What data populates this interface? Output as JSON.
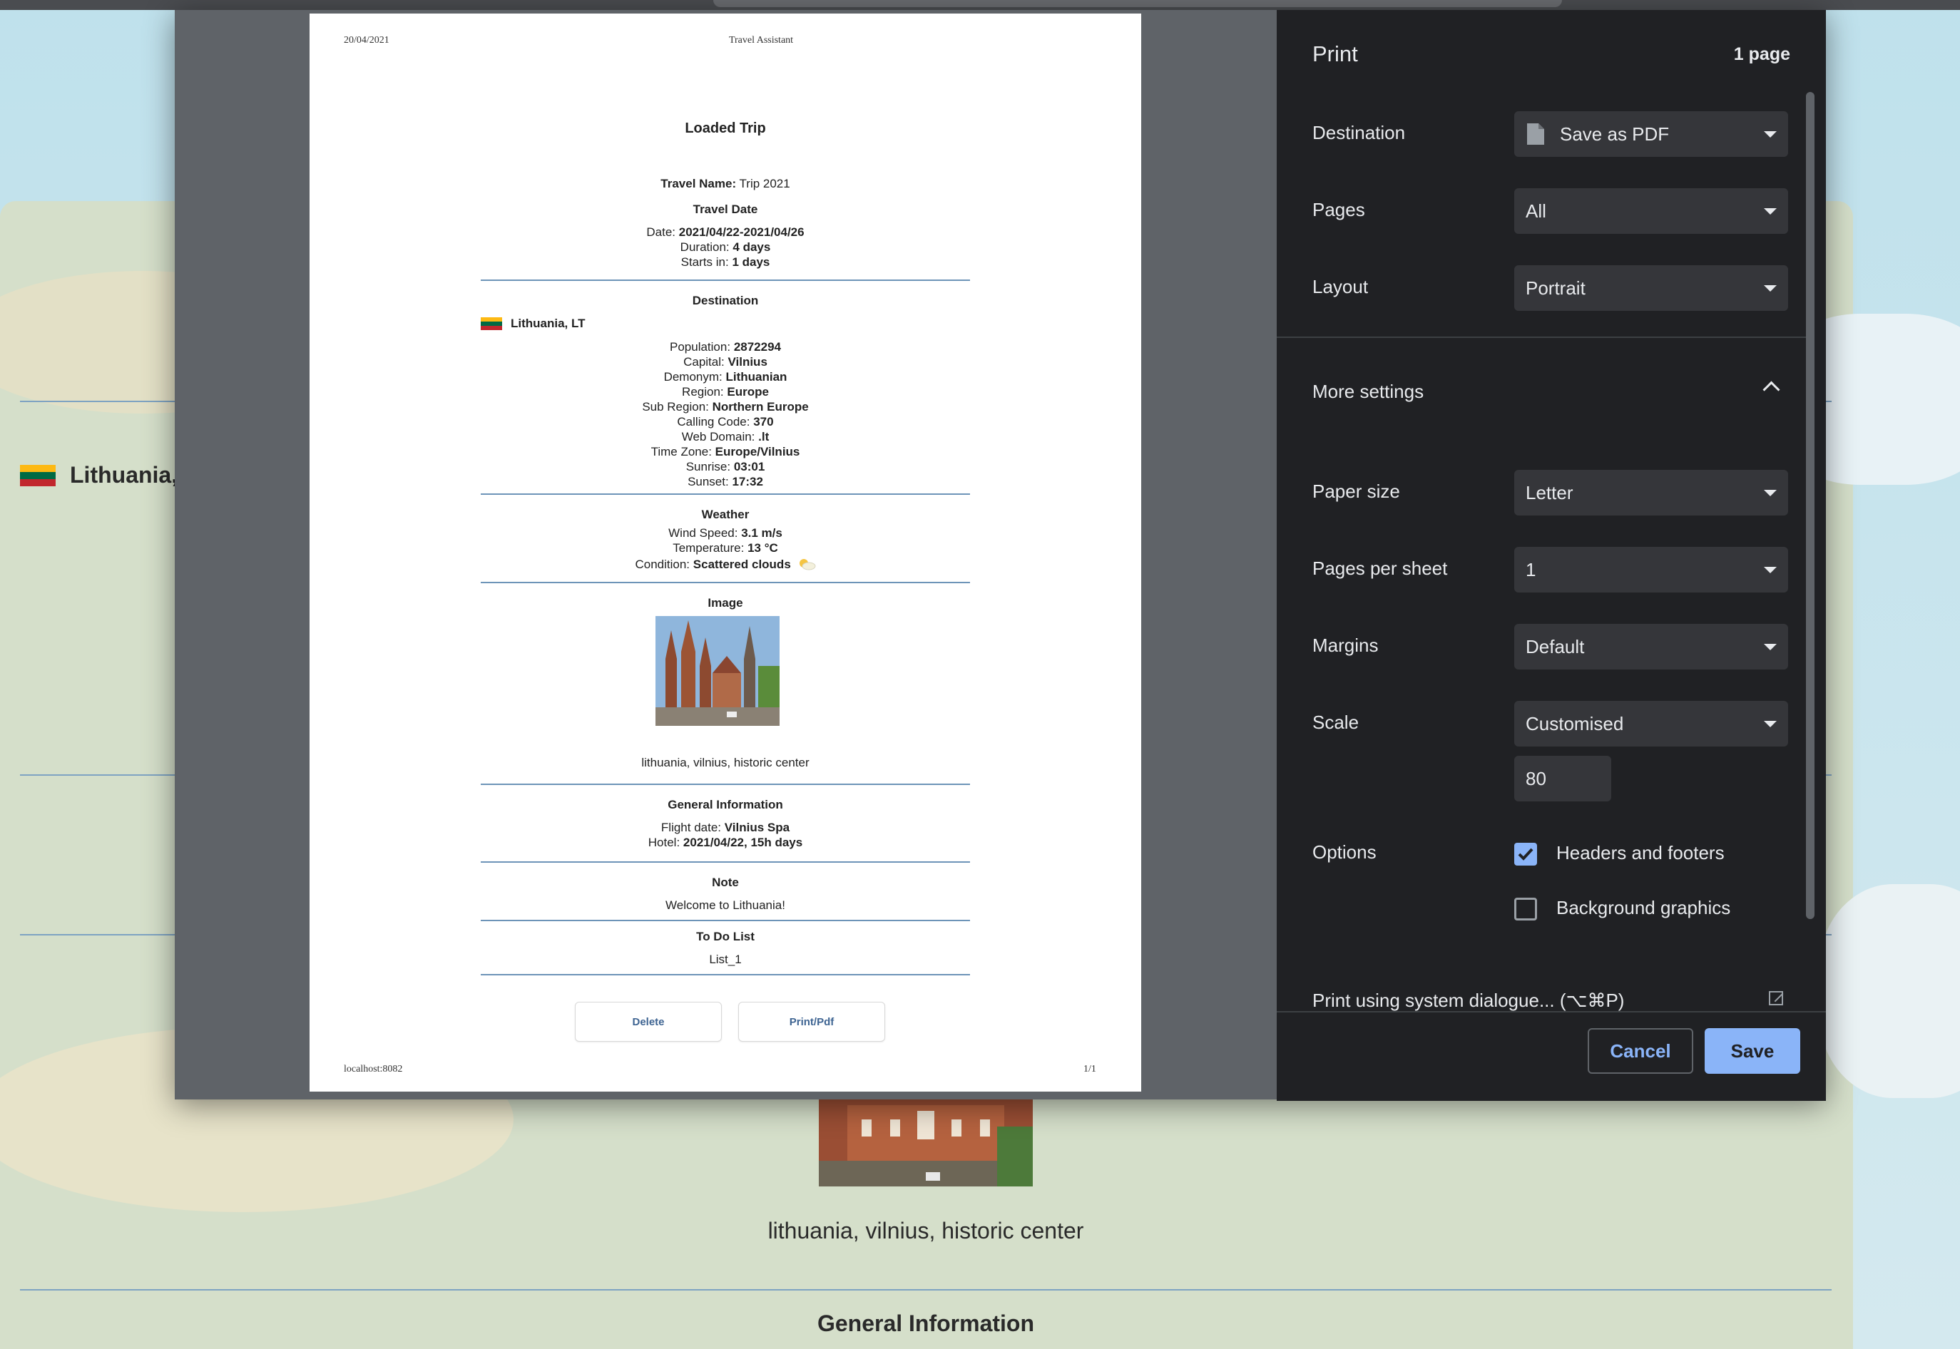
{
  "background": {
    "country": "Lithuania,",
    "image_caption": "lithuania, vilnius, historic center",
    "section_title": "General Information"
  },
  "preview": {
    "header_date": "20/04/2021",
    "header_title": "Travel Assistant",
    "footer_url": "localhost:8082",
    "footer_page": "1/1",
    "page_title": "Loaded Trip",
    "travel_name_label": "Travel Name:",
    "travel_name": "Trip 2021",
    "travel_date_heading": "Travel Date",
    "date_label": "Date:",
    "date_value": "2021/04/22-2021/04/26",
    "duration_label": "Duration:",
    "duration_value": "4 days",
    "starts_label": "Starts in:",
    "starts_value": "1 days",
    "destination_heading": "Destination",
    "country": "Lithuania, LT",
    "facts": [
      {
        "label": "Population:",
        "value": "2872294"
      },
      {
        "label": "Capital:",
        "value": "Vilnius"
      },
      {
        "label": "Demonym:",
        "value": "Lithuanian"
      },
      {
        "label": "Region:",
        "value": "Europe"
      },
      {
        "label": "Sub Region:",
        "value": "Northern Europe"
      },
      {
        "label": "Calling Code:",
        "value": "370"
      },
      {
        "label": "Web Domain:",
        "value": ".lt"
      },
      {
        "label": "Time Zone:",
        "value": "Europe/Vilnius"
      },
      {
        "label": "Sunrise:",
        "value": "03:01"
      },
      {
        "label": "Sunset:",
        "value": "17:32"
      }
    ],
    "weather_heading": "Weather",
    "wind_label": "Wind Speed:",
    "wind_value": "3.1 m/s",
    "temp_label": "Temperature:",
    "temp_value": "13 °C",
    "condition_label": "Condition:",
    "condition_value": "Scattered clouds",
    "image_heading": "Image",
    "image_caption": "lithuania, vilnius, historic center",
    "general_heading": "General Information",
    "flight_label": "Flight date:",
    "flight_value": "Vilnius Spa",
    "hotel_label": "Hotel:",
    "hotel_value": "2021/04/22, 15h days",
    "note_heading": "Note",
    "note_text": "Welcome to Lithuania!",
    "todo_heading": "To Do List",
    "todo_item": "List_1",
    "delete_button": "Delete",
    "print_button": "Print/Pdf"
  },
  "print_panel": {
    "title": "Print",
    "page_count": "1 page",
    "destination_label": "Destination",
    "destination_value": "Save as PDF",
    "pages_label": "Pages",
    "pages_value": "All",
    "layout_label": "Layout",
    "layout_value": "Portrait",
    "more_settings_label": "More settings",
    "paper_size_label": "Paper size",
    "paper_size_value": "Letter",
    "pages_per_sheet_label": "Pages per sheet",
    "pages_per_sheet_value": "1",
    "margins_label": "Margins",
    "margins_value": "Default",
    "scale_label": "Scale",
    "scale_value": "Customised",
    "scale_number": "80",
    "options_label": "Options",
    "headers_footers_label": "Headers and footers",
    "headers_footers_checked": true,
    "background_graphics_label": "Background graphics",
    "background_graphics_checked": false,
    "system_dialog_label": "Print using system dialogue... (⌥⌘P)",
    "cancel_label": "Cancel",
    "save_label": "Save"
  },
  "colors": {
    "panel_bg": "#202124",
    "accent": "#8ab4f8",
    "flag_yellow": "#fdb913",
    "flag_green": "#006a44",
    "flag_red": "#c1272d"
  }
}
